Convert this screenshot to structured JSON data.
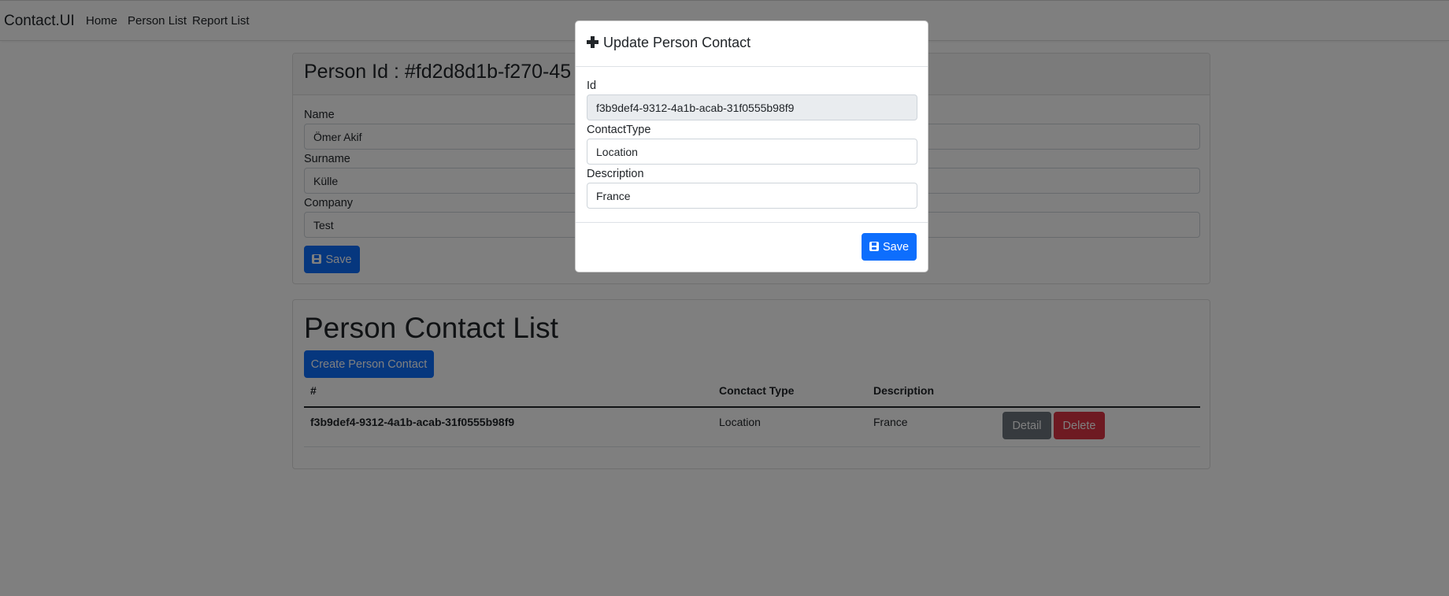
{
  "navbar": {
    "brand": "Contact.UI",
    "links": [
      "Home",
      "Person List",
      "Report List"
    ]
  },
  "person_card": {
    "title": "Person Id : #fd2d8d1b-f270-45",
    "name_label": "Name",
    "name_value": "Ömer Akif",
    "surname_label": "Surname",
    "surname_value": "Külle",
    "company_label": "Company",
    "company_value": "Test",
    "save_label": "Save"
  },
  "contact_list": {
    "title": "Person Contact List",
    "create_label": "Create Person Contact",
    "columns": [
      "#",
      "Conctact Type",
      "Description"
    ],
    "rows": [
      {
        "id": "f3b9def4-9312-4a1b-acab-31f0555b98f9",
        "type": "Location",
        "description": "France",
        "detail_label": "Detail",
        "delete_label": "Delete"
      }
    ]
  },
  "modal": {
    "title": "Update Person Contact",
    "id_label": "Id",
    "id_value": "f3b9def4-9312-4a1b-acab-31f0555b98f9",
    "contact_type_label": "ContactType",
    "contact_type_value": "Location",
    "description_label": "Description",
    "description_value": "France",
    "save_label": "Save"
  },
  "icons": {
    "modal_title": "plus-icon",
    "save": "save-icon"
  },
  "colors": {
    "primary": "#0d6efd",
    "secondary": "#6c757d",
    "danger": "#dc3545",
    "backdrop": "rgba(0,0,0,0.5)"
  }
}
